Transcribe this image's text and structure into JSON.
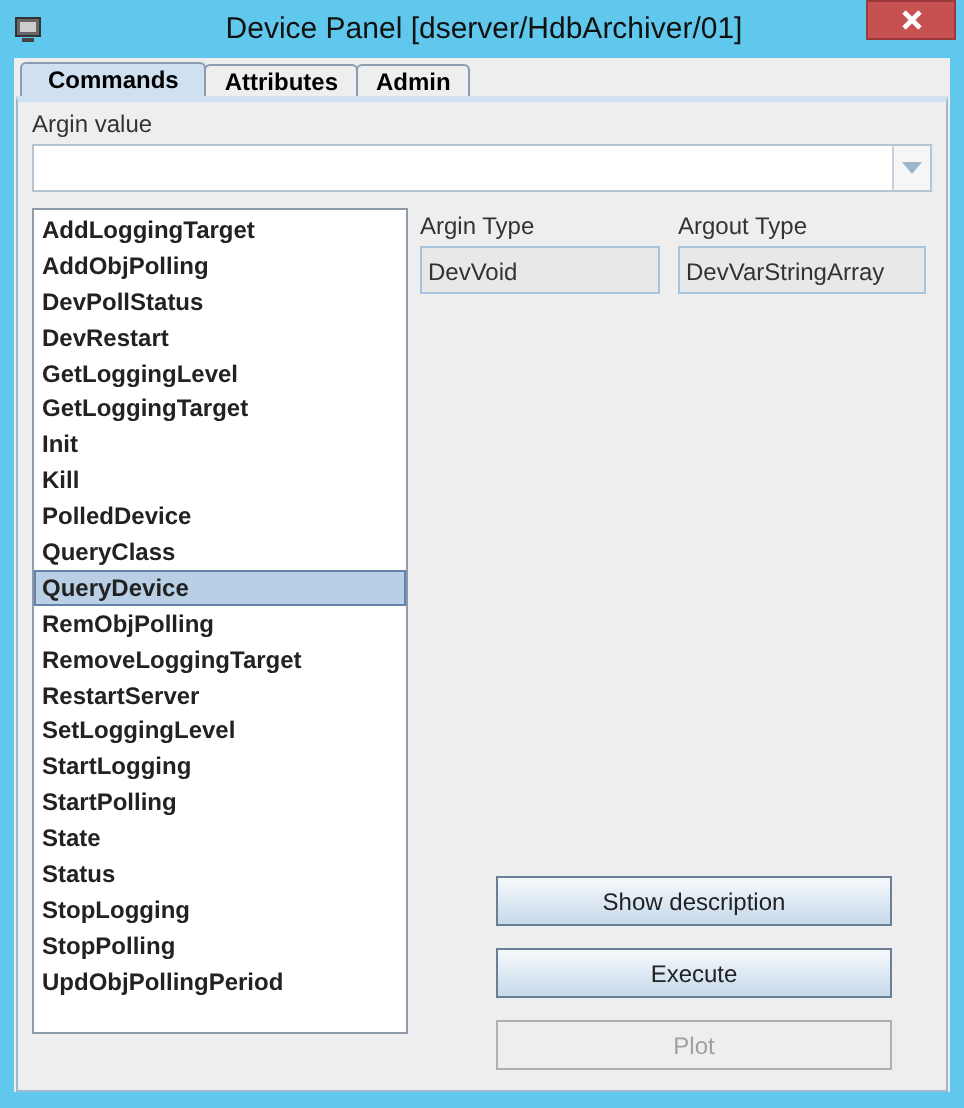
{
  "window": {
    "title": "Device Panel [dserver/HdbArchiver/01]"
  },
  "tabs": [
    {
      "label": "Commands",
      "selected": true
    },
    {
      "label": "Attributes",
      "selected": false
    },
    {
      "label": "Admin",
      "selected": false
    }
  ],
  "argin_value": {
    "label": "Argin value"
  },
  "commands": [
    {
      "label": "AddLoggingTarget",
      "selected": false
    },
    {
      "label": "AddObjPolling",
      "selected": false
    },
    {
      "label": "DevPollStatus",
      "selected": false
    },
    {
      "label": "DevRestart",
      "selected": false
    },
    {
      "label": "GetLoggingLevel",
      "selected": false
    },
    {
      "label": "GetLoggingTarget",
      "selected": false
    },
    {
      "label": "Init",
      "selected": false
    },
    {
      "label": "Kill",
      "selected": false
    },
    {
      "label": "PolledDevice",
      "selected": false
    },
    {
      "label": "QueryClass",
      "selected": false
    },
    {
      "label": "QueryDevice",
      "selected": true
    },
    {
      "label": "RemObjPolling",
      "selected": false
    },
    {
      "label": "RemoveLoggingTarget",
      "selected": false
    },
    {
      "label": "RestartServer",
      "selected": false
    },
    {
      "label": "SetLoggingLevel",
      "selected": false
    },
    {
      "label": "StartLogging",
      "selected": false
    },
    {
      "label": "StartPolling",
      "selected": false
    },
    {
      "label": "State",
      "selected": false
    },
    {
      "label": "Status",
      "selected": false
    },
    {
      "label": "StopLogging",
      "selected": false
    },
    {
      "label": "StopPolling",
      "selected": false
    },
    {
      "label": "UpdObjPollingPeriod",
      "selected": false
    }
  ],
  "argin_type": {
    "label": "Argin Type",
    "value": "DevVoid"
  },
  "argout_type": {
    "label": "Argout Type",
    "value": "DevVarStringArray"
  },
  "buttons": [
    {
      "label": "Show description",
      "disabled": false
    },
    {
      "label": "Execute",
      "disabled": false
    },
    {
      "label": "Plot",
      "disabled": true
    }
  ]
}
